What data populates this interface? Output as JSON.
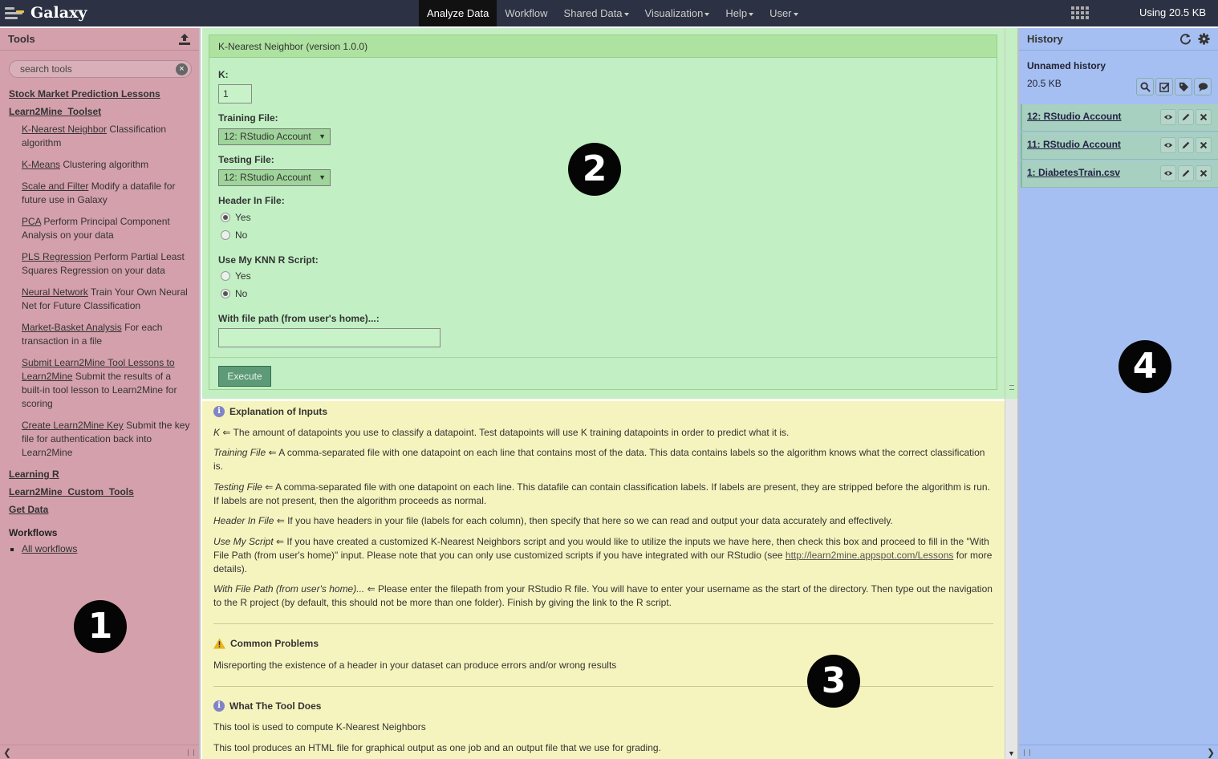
{
  "masthead": {
    "brand": "Galaxy",
    "nav": [
      {
        "label": "Analyze Data",
        "active": true,
        "dropdown": false
      },
      {
        "label": "Workflow",
        "active": false,
        "dropdown": false
      },
      {
        "label": "Shared Data",
        "active": false,
        "dropdown": true
      },
      {
        "label": "Visualization",
        "active": false,
        "dropdown": true
      },
      {
        "label": "Help",
        "active": false,
        "dropdown": true
      },
      {
        "label": "User",
        "active": false,
        "dropdown": true
      }
    ],
    "quota": "Using 20.5 KB"
  },
  "tools_panel": {
    "title": "Tools",
    "search_placeholder": "search tools",
    "sections_top": [
      "Stock Market Prediction Lessons",
      "Learn2Mine_Toolset"
    ],
    "tools": [
      {
        "link": "K-Nearest Neighbor",
        "desc": "Classification algorithm"
      },
      {
        "link": "K-Means",
        "desc": "Clustering algorithm"
      },
      {
        "link": "Scale and Filter",
        "desc": "Modify a datafile for future use in Galaxy"
      },
      {
        "link": "PCA",
        "desc": "Perform Principal Component Analysis on your data"
      },
      {
        "link": "PLS Regression",
        "desc": "Perform Partial Least Squares Regression on your data"
      },
      {
        "link": "Neural Network",
        "desc": "Train Your Own Neural Net for Future Classification"
      },
      {
        "link": "Market-Basket Analysis",
        "desc": "For each transaction in a file"
      },
      {
        "link": "Submit Learn2Mine Tool Lessons to Learn2Mine",
        "desc": "Submit the results of a built-in tool lesson to Learn2Mine for scoring"
      },
      {
        "link": "Create Learn2Mine Key",
        "desc": "Submit the key file for authentication back into Learn2Mine"
      }
    ],
    "sections_bottom": [
      "Learning R",
      "Learn2Mine_Custom_Tools",
      "Get Data"
    ],
    "workflows_title": "Workflows",
    "workflows_link": "All workflows"
  },
  "tool_form": {
    "title": "K-Nearest Neighbor (version 1.0.0)",
    "k_label": "K:",
    "k_value": "1",
    "training_label": "Training File:",
    "training_value": "12: RStudio Account",
    "testing_label": "Testing File:",
    "testing_value": "12: RStudio Account",
    "header_label": "Header In File:",
    "header_options": [
      {
        "label": "Yes",
        "checked": true
      },
      {
        "label": "No",
        "checked": false
      }
    ],
    "script_label": "Use My KNN R Script:",
    "script_options": [
      {
        "label": "Yes",
        "checked": false
      },
      {
        "label": "No",
        "checked": true
      }
    ],
    "path_label": "With file path (from user's home)...:",
    "path_value": "",
    "execute_label": "Execute"
  },
  "help": {
    "explanation_heading": "Explanation of Inputs",
    "items": [
      {
        "term": "K",
        "text": " ⇐ The amount of datapoints you use to classify a datapoint. Test datapoints will use K training datapoints in order to predict what it is."
      },
      {
        "term": "Training File",
        "text": " ⇐ A comma-separated file with one datapoint on each line that contains most of the data. This data contains labels so the algorithm knows what the correct classification is."
      },
      {
        "term": "Testing File",
        "text": " ⇐ A comma-separated file with one datapoint on each line. This datafile can contain classification labels. If labels are present, they are stripped before the algorithm is run. If labels are not present, then the algorithm proceeds as normal."
      },
      {
        "term": "Header In File",
        "text": " ⇐ If you have headers in your file (labels for each column), then specify that here so we can read and output your data accurately and effectively."
      },
      {
        "term": "Use My Script",
        "text": " ⇐ If you have created a customized K-Nearest Neighbors script and you would like to utilize the inputs we have here, then check this box and proceed to fill in the \"With File Path (from user's home)\" input. Please note that you can only use customized scripts if you have integrated with our RStudio (see ",
        "link": "http://learn2mine.appspot.com/Lessons",
        "after": " for more details)."
      },
      {
        "term": "With File Path (from user's home)...",
        "text": " ⇐ Please enter the filepath from your RStudio R file. You will have to enter your username as the start of the directory. Then type out the navigation to the R project (by default, this should not be more than one folder). Finish by giving the link to the R script."
      }
    ],
    "problems_heading": "Common Problems",
    "problems_text": "Misreporting the existence of a header in your dataset can produce errors and/or wrong results",
    "what_heading": "What The Tool Does",
    "what_text_1": "This tool is used to compute K-Nearest Neighbors",
    "what_text_2": "This tool produces an HTML file for graphical output as one job and an output file that we use for grading."
  },
  "history": {
    "title": "History",
    "name": "Unnamed history",
    "size": "20.5 KB",
    "datasets": [
      {
        "title": "12: RStudio Account"
      },
      {
        "title": "11: RStudio Account"
      },
      {
        "title": "1: DiabetesTrain.csv"
      }
    ]
  },
  "callouts": [
    "1",
    "2",
    "3",
    "4"
  ],
  "colors": {
    "masthead": "#2c3143",
    "tools_panel": "#d4a0ac",
    "form_area": "#c3efc3",
    "help_area": "#f6f4be",
    "history_panel": "#a6bff2",
    "execute_button": "#5c9a78"
  }
}
